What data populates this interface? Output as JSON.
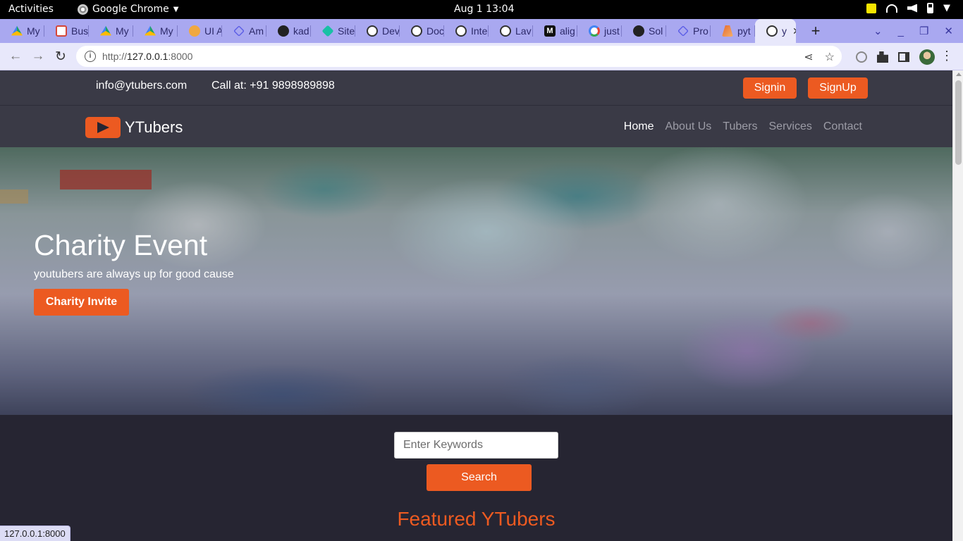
{
  "system": {
    "activities": "Activities",
    "app_name": "Google Chrome",
    "clock": "Aug 1  13:04"
  },
  "browser": {
    "tabs": [
      {
        "label": "My",
        "icon": "drive"
      },
      {
        "label": "Bus",
        "icon": "gmail"
      },
      {
        "label": "My",
        "icon": "drive"
      },
      {
        "label": "My",
        "icon": "drive"
      },
      {
        "label": "UI A",
        "icon": "w"
      },
      {
        "label": "Am",
        "icon": "flow"
      },
      {
        "label": "kad",
        "icon": "gh"
      },
      {
        "label": "Site",
        "icon": "site"
      },
      {
        "label": "Dev",
        "icon": "globe"
      },
      {
        "label": "Doc",
        "icon": "globe"
      },
      {
        "label": "Inte",
        "icon": "globe"
      },
      {
        "label": "Lav",
        "icon": "globe"
      },
      {
        "label": "alig",
        "icon": "m"
      },
      {
        "label": "just",
        "icon": "g"
      },
      {
        "label": "Sol",
        "icon": "gh"
      },
      {
        "label": "Pro",
        "icon": "flow"
      },
      {
        "label": "pyt",
        "icon": "py"
      }
    ],
    "active_tab": {
      "label": "y",
      "icon": "globe"
    },
    "url_scheme": "http://",
    "url_host": "127.0.0.1",
    "url_rest": ":8000",
    "status_url": "127.0.0.1:8000"
  },
  "page": {
    "topbar": {
      "email": "info@ytubers.com",
      "phone": "Call at: +91 9898989898",
      "signin": "Signin",
      "signup": "SignUp"
    },
    "logo_text": "YTubers",
    "nav": [
      "Home",
      "About Us",
      "Tubers",
      "Services",
      "Contact"
    ],
    "nav_active": "Home",
    "hero": {
      "title": "Charity Event",
      "subtitle": "youtubers are always up for good cause",
      "cta": "Charity Invite"
    },
    "search": {
      "placeholder": "Enter Keywords",
      "button": "Search"
    },
    "featured_heading": "Featured YTubers"
  },
  "colors": {
    "accent": "#ec5a21",
    "page_bg": "#262532",
    "header_bg": "#3a3a46",
    "tabstrip": "#a9a8f0"
  }
}
